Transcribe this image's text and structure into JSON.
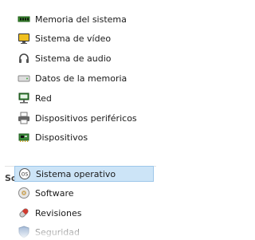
{
  "hardware_items": [
    {
      "label": "Memoria del sistema",
      "icon": "memory-module-icon"
    },
    {
      "label": "Sistema de vídeo",
      "icon": "monitor-icon"
    },
    {
      "label": "Sistema de audio",
      "icon": "headphones-icon"
    },
    {
      "label": "Datos de la memoria",
      "icon": "storage-drive-icon"
    },
    {
      "label": "Red",
      "icon": "network-icon"
    },
    {
      "label": "Dispositivos periféricos",
      "icon": "printer-icon"
    },
    {
      "label": "Dispositivos",
      "icon": "device-board-icon"
    }
  ],
  "software_section": {
    "title": "Software",
    "toggle_icon": "triangle-down-icon",
    "items": [
      {
        "label": "Sistema operativo",
        "icon": "os-icon",
        "selected": true
      },
      {
        "label": "Software",
        "icon": "disc-icon"
      },
      {
        "label": "Revisiones",
        "icon": "pill-icon"
      },
      {
        "label": "Seguridad",
        "icon": "security-icon"
      }
    ]
  },
  "colors": {
    "selection_bg": "#cce4f7",
    "selection_border": "#9dc6ea",
    "header_text": "#444444"
  }
}
